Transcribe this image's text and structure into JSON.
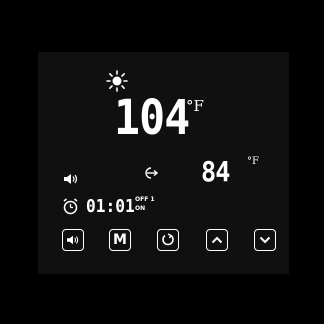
{
  "thermostat": {
    "setpoint": "104",
    "setpoint_unit": "°F",
    "current_temp": "84",
    "current_unit": "°F",
    "timer_time": "01:01",
    "timer_off": "OFF 1",
    "timer_on": "ON",
    "mode_button_label": "M"
  },
  "icons": {
    "sun": "sun-icon",
    "arrow": "arrow-in-icon",
    "speaker": "speaker-icon",
    "clock": "alarm-clock-icon"
  },
  "colors": {
    "background": "#000000",
    "panel": "#101010",
    "foreground": "#ffffff"
  }
}
